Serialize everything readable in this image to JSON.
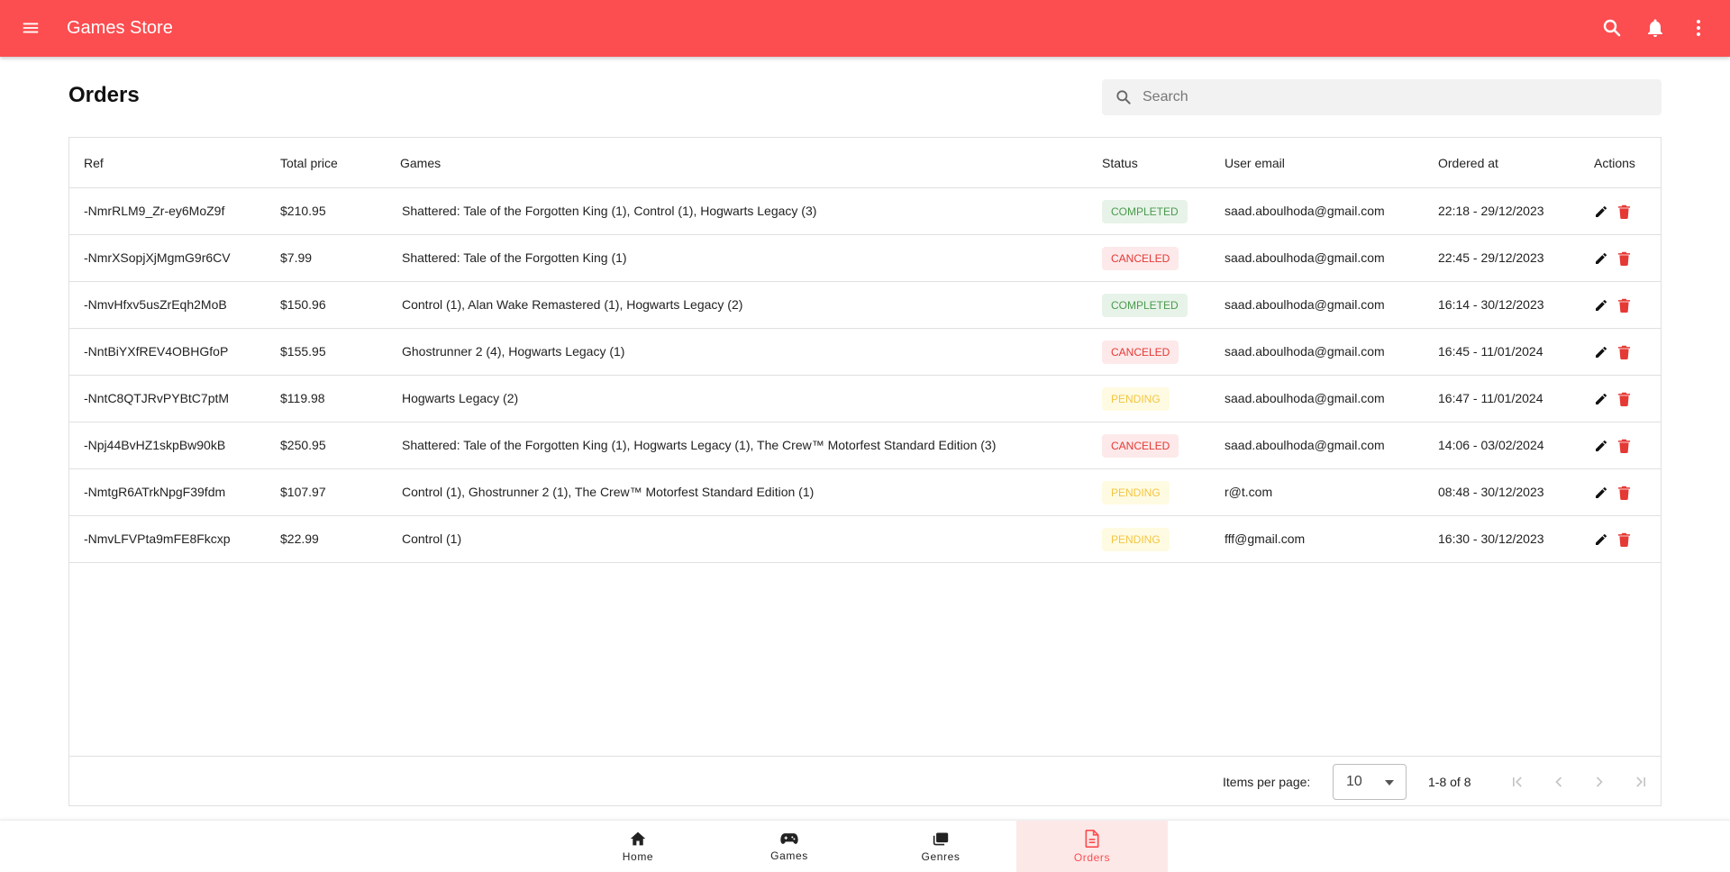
{
  "app": {
    "title": "Games Store"
  },
  "page": {
    "title": "Orders"
  },
  "search": {
    "placeholder": "Search"
  },
  "table": {
    "columns": {
      "ref": "Ref",
      "total_price": "Total price",
      "games": "Games",
      "status": "Status",
      "user_email": "User email",
      "ordered_at": "Ordered at",
      "actions": "Actions"
    },
    "rows": [
      {
        "ref": "-NmrRLM9_Zr-ey6MoZ9f",
        "total": "$210.95",
        "games": "Shattered: Tale of the Forgotten King (1), Control (1), Hogwarts Legacy (3)",
        "status": "COMPLETED",
        "status_key": "completed",
        "email": "saad.aboulhoda@gmail.com",
        "ordered_at": "22:18 - 29/12/2023"
      },
      {
        "ref": "-NmrXSopjXjMgmG9r6CV",
        "total": "$7.99",
        "games": "Shattered: Tale of the Forgotten King (1)",
        "status": "CANCELED",
        "status_key": "canceled",
        "email": "saad.aboulhoda@gmail.com",
        "ordered_at": "22:45 - 29/12/2023"
      },
      {
        "ref": "-NmvHfxv5usZrEqh2MoB",
        "total": "$150.96",
        "games": "Control (1), Alan Wake Remastered (1), Hogwarts Legacy (2)",
        "status": "COMPLETED",
        "status_key": "completed",
        "email": "saad.aboulhoda@gmail.com",
        "ordered_at": "16:14 - 30/12/2023"
      },
      {
        "ref": "-NntBiYXfREV4OBHGfoP",
        "total": "$155.95",
        "games": "Ghostrunner 2 (4), Hogwarts Legacy (1)",
        "status": "CANCELED",
        "status_key": "canceled",
        "email": "saad.aboulhoda@gmail.com",
        "ordered_at": "16:45 - 11/01/2024"
      },
      {
        "ref": "-NntC8QTJRvPYBtC7ptM",
        "total": "$119.98",
        "games": "Hogwarts Legacy (2)",
        "status": "PENDING",
        "status_key": "pending",
        "email": "saad.aboulhoda@gmail.com",
        "ordered_at": "16:47 - 11/01/2024"
      },
      {
        "ref": "-Npj44BvHZ1skpBw90kB",
        "total": "$250.95",
        "games": "Shattered: Tale of the Forgotten King (1), Hogwarts Legacy (1), The Crew™ Motorfest Standard Edition (3)",
        "status": "CANCELED",
        "status_key": "canceled",
        "email": "saad.aboulhoda@gmail.com",
        "ordered_at": "14:06 - 03/02/2024"
      },
      {
        "ref": "-NmtgR6ATrkNpgF39fdm",
        "total": "$107.97",
        "games": "Control (1), Ghostrunner 2 (1), The Crew™ Motorfest Standard Edition (1)",
        "status": "PENDING",
        "status_key": "pending",
        "email": "r@t.com",
        "ordered_at": "08:48 - 30/12/2023"
      },
      {
        "ref": "-NmvLFVPta9mFE8Fkcxp",
        "total": "$22.99",
        "games": "Control (1)",
        "status": "PENDING",
        "status_key": "pending",
        "email": "fff@gmail.com",
        "ordered_at": "16:30 - 30/12/2023"
      }
    ]
  },
  "pagination": {
    "items_per_page_label": "Items per page:",
    "items_per_page_value": "10",
    "range_label": "1-8 of 8"
  },
  "bottom_nav": {
    "items": [
      {
        "label": "Home",
        "icon": "home-icon"
      },
      {
        "label": "Games",
        "icon": "gamepad-icon"
      },
      {
        "label": "Genres",
        "icon": "genres-icon"
      },
      {
        "label": "Orders",
        "icon": "orders-icon",
        "active": true
      }
    ]
  },
  "colors": {
    "primary": "#fc4d50",
    "completed": "#4b9a4f",
    "canceled": "#e53935",
    "pending": "#f4c542",
    "delete": "#e53935"
  }
}
